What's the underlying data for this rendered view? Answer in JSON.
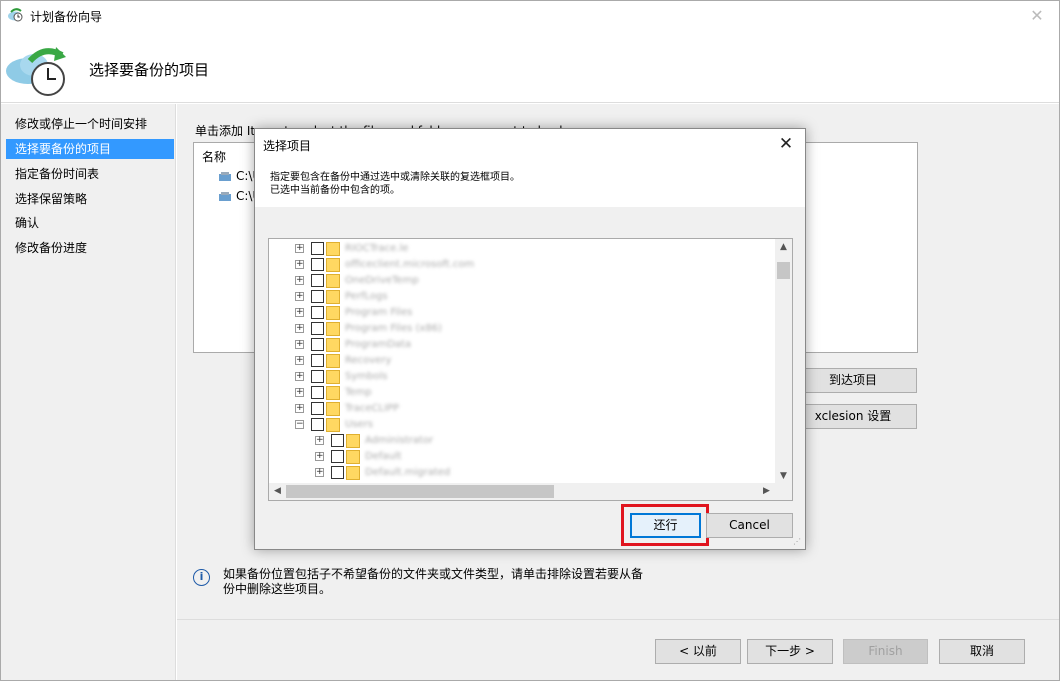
{
  "window": {
    "title": "计划备份向导",
    "close_glyph": "✕"
  },
  "header": {
    "heading": "选择要备份的项目",
    "icon": "backup-clock-icon"
  },
  "sidebar": {
    "steps": [
      {
        "label": "修改或停止一个时间安排",
        "active": false
      },
      {
        "label": "选择要备份的项目",
        "active": true
      },
      {
        "label": "指定备份时间表",
        "active": false
      },
      {
        "label": "选择保留策略",
        "active": false
      },
      {
        "label": "确认",
        "active": false
      },
      {
        "label": "修改备份进度",
        "active": false
      }
    ]
  },
  "main": {
    "add_label": "单击添加  Items to select the files and folders you want to backup",
    "items_header": "名称",
    "items": [
      "C:\\U",
      "C:\\U"
    ],
    "add_items_button": "到达项目",
    "exclusion_button": "xclesion 设置",
    "info_text": "如果备份位置包括子不希望备份的文件夹或文件类型，请单击排除设置若要从备份中删除这些项目。"
  },
  "footer": {
    "prev": "< 以前",
    "next": "下一步 >",
    "finish": "Finish",
    "cancel": "取消"
  },
  "dialog": {
    "title": "选择项目",
    "close_glyph": "✕",
    "desc_line1": "指定要包含在备份中通过选中或清除关联的复选框项目。",
    "desc_line2": "已选中当前备份中包含的项。",
    "tree": [
      {
        "label": "RIOCTrace.le",
        "level": 0,
        "expander": "+"
      },
      {
        "label": "officeclient.microsoft.com",
        "level": 0,
        "expander": "+"
      },
      {
        "label": "OneDriveTemp",
        "level": 0,
        "expander": "+"
      },
      {
        "label": "PerfLogs",
        "level": 0,
        "expander": "+"
      },
      {
        "label": "Program Files",
        "level": 0,
        "expander": "+"
      },
      {
        "label": "Program Files (x86)",
        "level": 0,
        "expander": "+"
      },
      {
        "label": "ProgramData",
        "level": 0,
        "expander": "+"
      },
      {
        "label": "Recovery",
        "level": 0,
        "expander": "+"
      },
      {
        "label": "Symbols",
        "level": 0,
        "expander": "+"
      },
      {
        "label": "Temp",
        "level": 0,
        "expander": "+"
      },
      {
        "label": "TraceCLIPP",
        "level": 0,
        "expander": "+"
      },
      {
        "label": "Users",
        "level": 0,
        "expander": "−"
      },
      {
        "label": "Administrator",
        "level": 1,
        "expander": "+"
      },
      {
        "label": "Default",
        "level": 1,
        "expander": "+"
      },
      {
        "label": "Default.migrated",
        "level": 1,
        "expander": "+"
      }
    ],
    "restore_button": "还行",
    "cancel_button": "Cancel"
  }
}
